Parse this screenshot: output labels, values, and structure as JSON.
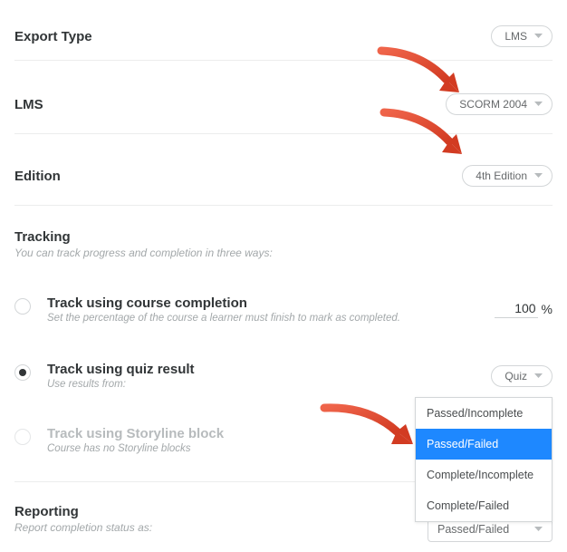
{
  "export_type": {
    "label": "Export Type",
    "value": "LMS"
  },
  "lms": {
    "label": "LMS",
    "value": "SCORM 2004"
  },
  "edition": {
    "label": "Edition",
    "value": "4th Edition"
  },
  "tracking": {
    "label": "Tracking",
    "subtitle": "You can track progress and completion in three ways:",
    "options": {
      "course_completion": {
        "title": "Track using course completion",
        "sub": "Set the percentage of the course a learner must finish to mark as completed.",
        "percent_value": "100",
        "percent_suffix": "%"
      },
      "quiz_result": {
        "title": "Track using quiz result",
        "sub": "Use results from:",
        "dropdown_value": "Quiz"
      },
      "storyline": {
        "title": "Track using Storyline block",
        "sub": "Course has no Storyline blocks"
      }
    }
  },
  "reporting": {
    "label": "Reporting",
    "subtitle": "Report completion status as:",
    "select_value": "Passed/Failed",
    "options": [
      "Passed/Incomplete",
      "Passed/Failed",
      "Complete/Incomplete",
      "Complete/Failed"
    ]
  }
}
